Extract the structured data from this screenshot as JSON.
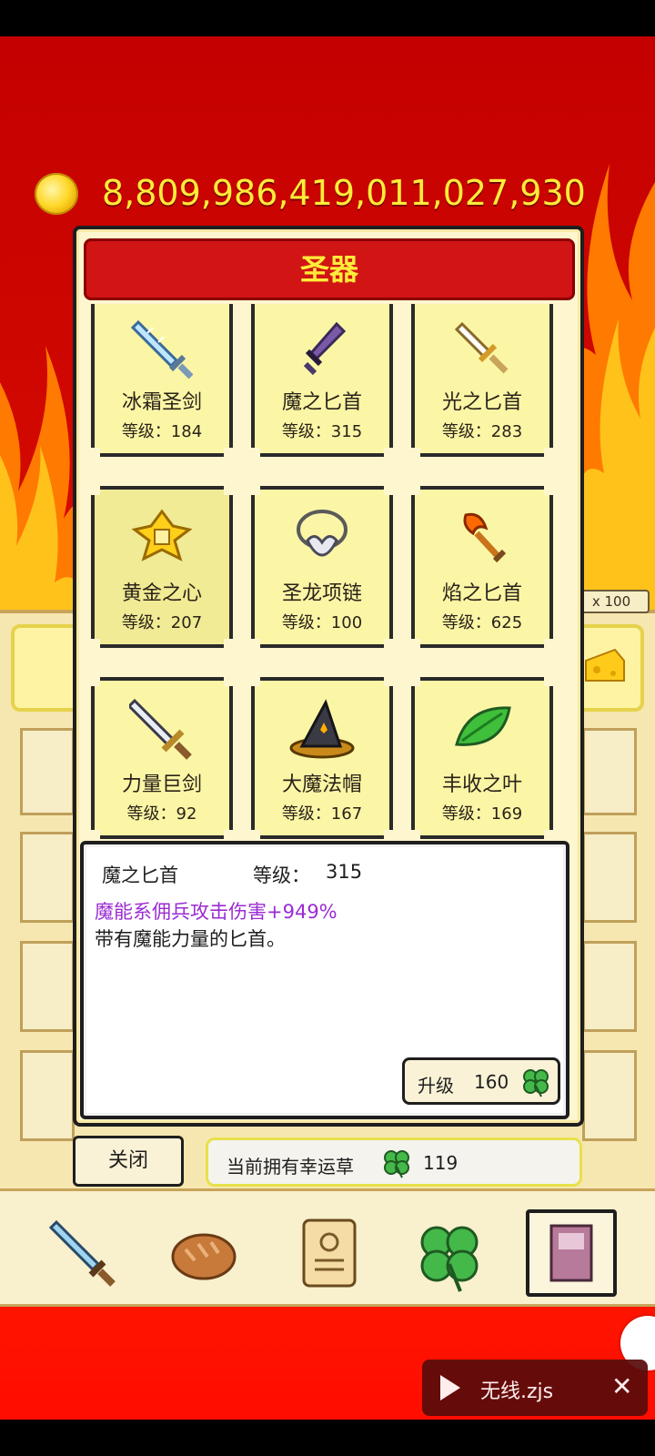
{
  "hud": {
    "coin_icon": "gold-coin-icon",
    "coin_value": "8,809,986,419,011,027,930"
  },
  "background": {
    "qty_badge": "x 100"
  },
  "modal": {
    "title": "圣器",
    "items": [
      {
        "name": "冰霜圣剑",
        "level": "等级：184",
        "icon": "frost-sword-icon"
      },
      {
        "name": "魔之匕首",
        "level": "等级：315",
        "icon": "magic-dagger-icon"
      },
      {
        "name": "光之匕首",
        "level": "等级：283",
        "icon": "light-dagger-icon"
      },
      {
        "name": "黄金之心",
        "level": "等级：207",
        "icon": "golden-heart-icon"
      },
      {
        "name": "圣龙项链",
        "level": "等级：100",
        "icon": "dragon-necklace-icon"
      },
      {
        "name": "焰之匕首",
        "level": "等级：625",
        "icon": "flame-dagger-icon"
      },
      {
        "name": "力量巨剑",
        "level": "等级：92",
        "icon": "power-greatsword-icon"
      },
      {
        "name": "大魔法帽",
        "level": "等级：167",
        "icon": "wizard-hat-icon"
      },
      {
        "name": "丰收之叶",
        "level": "等级：169",
        "icon": "harvest-leaf-icon"
      }
    ]
  },
  "detail": {
    "name": "魔之匕首",
    "level_label": "等级：",
    "level_value": "315",
    "effect": "魔能系佣兵攻击伤害+949%",
    "description": "带有魔能力量的匕首。",
    "upgrade_label": "升级",
    "upgrade_cost": "160",
    "upgrade_icon": "clover-icon"
  },
  "footer": {
    "close_label": "关闭",
    "clover_label": "当前拥有幸运草",
    "clover_count": "119"
  },
  "bottom_nav": [
    {
      "icon": "sword-icon"
    },
    {
      "icon": "bread-icon"
    },
    {
      "icon": "scroll-icon"
    },
    {
      "icon": "clover-icon"
    },
    {
      "icon": "book-icon",
      "active": true
    }
  ],
  "overlay": {
    "video_label": "无线.zjs",
    "close_glyph": "✕"
  },
  "colors": {
    "title_bar": "#d11414",
    "title_text": "#ffec3a",
    "coin_text": "#ffec3a",
    "effect_text": "#9b2bd3",
    "card_bg": "#fbf6a6"
  }
}
